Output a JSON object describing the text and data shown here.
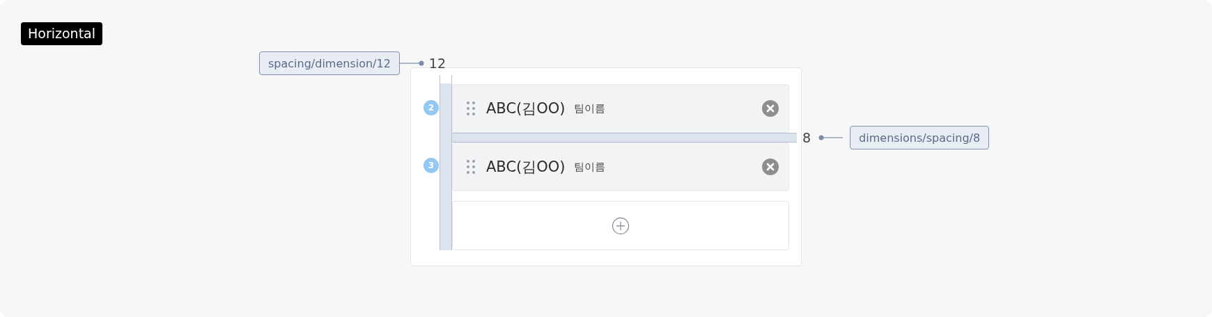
{
  "label": "Horizontal",
  "annotations": [
    {
      "kind": "left",
      "token": "spacing/dimension/12",
      "value": "12"
    },
    {
      "kind": "right",
      "token": "dimensions/spacing/8",
      "value": "8"
    }
  ],
  "items": [
    {
      "badge": "2",
      "name": "ABC(김OO)",
      "team": "팀이름"
    },
    {
      "badge": "3",
      "name": "ABC(김OO)",
      "team": "팀이름"
    }
  ]
}
